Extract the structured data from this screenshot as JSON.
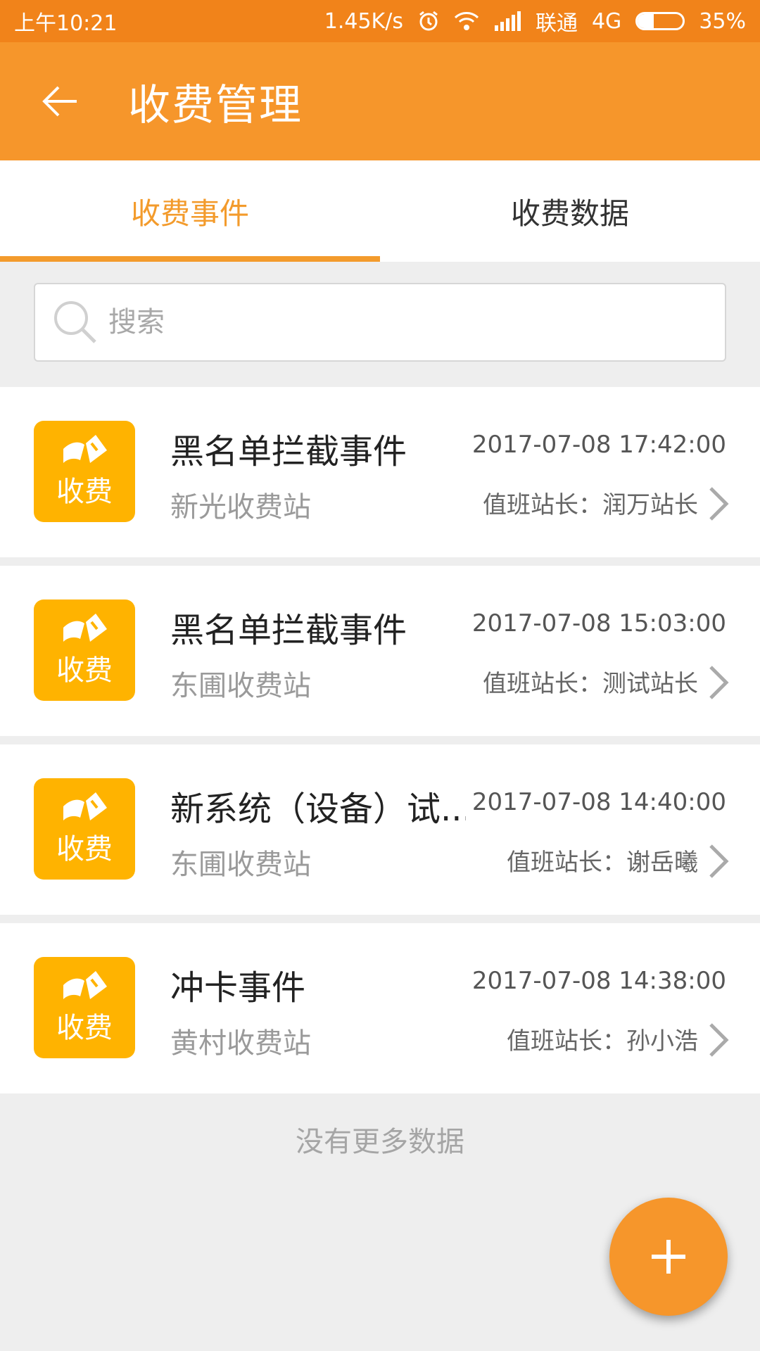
{
  "status_bar": {
    "time": "上午10:21",
    "speed": "1.45K/s",
    "carrier": "联通",
    "network": "4G",
    "battery": "35%",
    "battery_level": 0.35,
    "icons": [
      "alarm-icon",
      "wifi-icon",
      "signal-icon",
      "battery-icon"
    ]
  },
  "header": {
    "title": "收费管理",
    "back_icon": "back-arrow-icon"
  },
  "tabs": [
    {
      "label": "收费事件",
      "active": true
    },
    {
      "label": "收费数据",
      "active": false
    }
  ],
  "search": {
    "placeholder": "搜索",
    "value": ""
  },
  "events": [
    {
      "badge": "收费",
      "title": "黑名单拦截事件",
      "station": "新光收费站",
      "time": "2017-07-08 17:42:00",
      "duty": "值班站长：润万站长"
    },
    {
      "badge": "收费",
      "title": "黑名单拦截事件",
      "station": "东圃收费站",
      "time": "2017-07-08 15:03:00",
      "duty": "值班站长：测试站长"
    },
    {
      "badge": "收费",
      "title": "新系统（设备）试...",
      "station": "东圃收费站",
      "time": "2017-07-08 14:40:00",
      "duty": "值班站长：谢岳曦"
    },
    {
      "badge": "收费",
      "title": "冲卡事件",
      "station": "黄村收费站",
      "time": "2017-07-08 14:38:00",
      "duty": "值班站长：孙小浩"
    }
  ],
  "footer": {
    "no_more": "没有更多数据"
  },
  "colors": {
    "status_bar": "#f1831a",
    "app_bar": "#f6962b",
    "accent": "#f39b2c",
    "badge": "#ffb300"
  }
}
